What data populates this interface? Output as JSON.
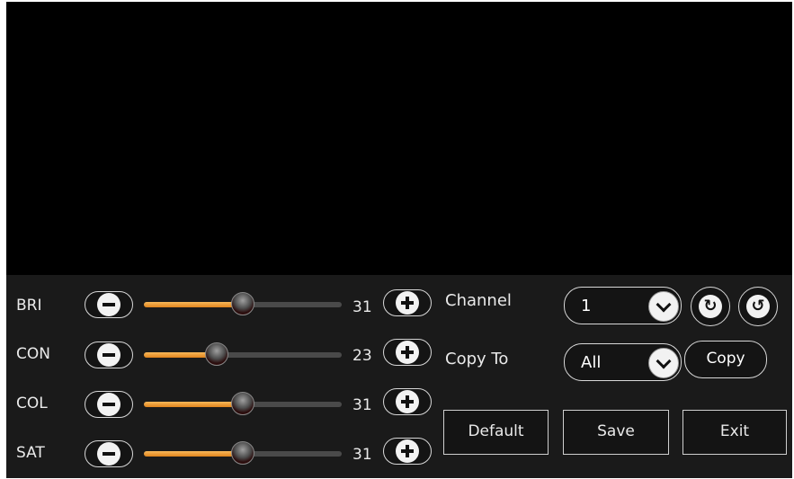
{
  "rows": [
    {
      "label": "BRI",
      "value": "31",
      "level": 0.5
    },
    {
      "label": "CON",
      "value": "23",
      "level": 0.37
    },
    {
      "label": "COL",
      "value": "31",
      "level": 0.5
    },
    {
      "label": "SAT",
      "value": "31",
      "level": 0.5
    }
  ],
  "channel": {
    "label": "Channel",
    "selected": "1"
  },
  "copy_to": {
    "label": "Copy To",
    "selected": "All",
    "copy_button": "Copy"
  },
  "buttons": {
    "default": "Default",
    "save": "Save",
    "exit": "Exit"
  },
  "colors": {
    "slider_fill": "#e8922a",
    "panel_bg": "#1a1a1a",
    "preview_bg": "#000000"
  }
}
